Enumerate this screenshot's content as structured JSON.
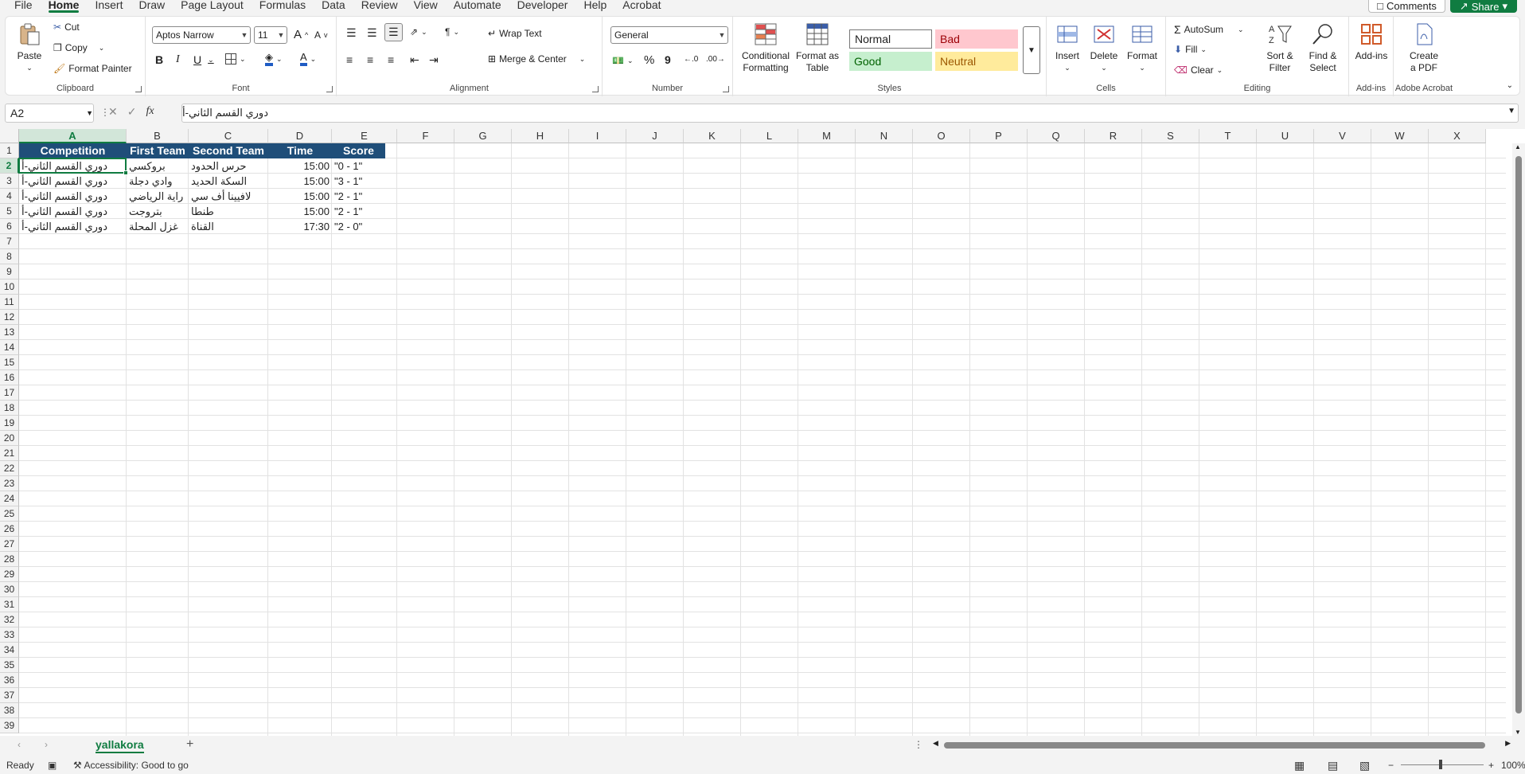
{
  "menu": {
    "items": [
      "File",
      "Home",
      "Insert",
      "Draw",
      "Page Layout",
      "Formulas",
      "Data",
      "Review",
      "View",
      "Automate",
      "Developer",
      "Help",
      "Acrobat"
    ],
    "active": "Home",
    "comments": "Comments",
    "share": "Share"
  },
  "ribbon": {
    "clipboard": {
      "label": "Clipboard",
      "paste": "Paste",
      "cut": "Cut",
      "copy": "Copy",
      "format_painter": "Format Painter"
    },
    "font": {
      "label": "Font",
      "family": "Aptos Narrow",
      "size": "11",
      "bold": "B",
      "italic": "I",
      "underline": "U",
      "grow": "A",
      "shrink": "A"
    },
    "alignment": {
      "label": "Alignment",
      "wrap_text": "Wrap Text",
      "merge_center": "Merge & Center"
    },
    "number": {
      "label": "Number",
      "format": "General",
      "percent": "%",
      "comma": "9"
    },
    "styles": {
      "label": "Styles",
      "conditional": "Conditional Formatting",
      "format_table": "Format as Table",
      "normal": "Normal",
      "bad": "Bad",
      "good": "Good",
      "neutral": "Neutral"
    },
    "cells": {
      "label": "Cells",
      "insert": "Insert",
      "delete": "Delete",
      "format": "Format"
    },
    "editing": {
      "label": "Editing",
      "autosum": "AutoSum",
      "fill": "Fill",
      "clear": "Clear",
      "sort_filter": "Sort & Filter",
      "find_select": "Find & Select"
    },
    "addins": {
      "label": "Add-ins",
      "addins": "Add-ins"
    },
    "acrobat": {
      "label": "Adobe Acrobat",
      "create_pdf": "Create a PDF"
    }
  },
  "formula_bar": {
    "name_box": "A2",
    "fx": "fx",
    "value": "دوري القسم الثاني-أ"
  },
  "grid": {
    "columns": [
      "A",
      "B",
      "C",
      "D",
      "E",
      "F",
      "G",
      "H",
      "I",
      "J",
      "K",
      "L",
      "M",
      "N",
      "O",
      "P",
      "Q",
      "R",
      "S",
      "T",
      "U",
      "V",
      "W",
      "X"
    ],
    "rows": [
      "1",
      "2",
      "3",
      "4",
      "5",
      "6",
      "7",
      "8",
      "9",
      "10",
      "11",
      "12",
      "13",
      "14",
      "15",
      "16",
      "17",
      "18",
      "19",
      "20",
      "21",
      "22",
      "23",
      "24",
      "25",
      "26",
      "27",
      "28",
      "29",
      "30",
      "31",
      "32",
      "33",
      "34",
      "35",
      "36",
      "37",
      "38",
      "39"
    ],
    "headers": [
      "Competition",
      "First Team",
      "Second Team",
      "Time",
      "Score"
    ],
    "data": [
      [
        "دوري القسم الثاني-أ",
        "بروكسي",
        "حرس الحدود",
        "15:00",
        "\"0 - 1\""
      ],
      [
        "دوري القسم الثاني-أ",
        "وادي دجلة",
        "السكة الحديد",
        "15:00",
        "\"3 - 1\""
      ],
      [
        "دوري القسم الثاني-أ",
        "راية الرياضي",
        "لافيينا أف سي",
        "15:00",
        "\"2 - 1\""
      ],
      [
        "دوري القسم الثاني-أ",
        "بتروجت",
        "طنطا",
        "15:00",
        "\"2 - 1\""
      ],
      [
        "دوري القسم الثاني-أ",
        "غزل المحلة",
        "القناة",
        "17:30",
        "\"2 - 0\""
      ]
    ]
  },
  "sheets": {
    "active": "yallakora",
    "add": "+"
  },
  "status": {
    "ready": "Ready",
    "accessibility": "Accessibility: Good to go",
    "zoom": "100%"
  },
  "colors": {
    "accent": "#107c41",
    "header_fill": "#1f4e79",
    "bad_fill": "#ffc7ce",
    "good_fill": "#c6efce",
    "neutral_fill": "#ffeb9c"
  }
}
